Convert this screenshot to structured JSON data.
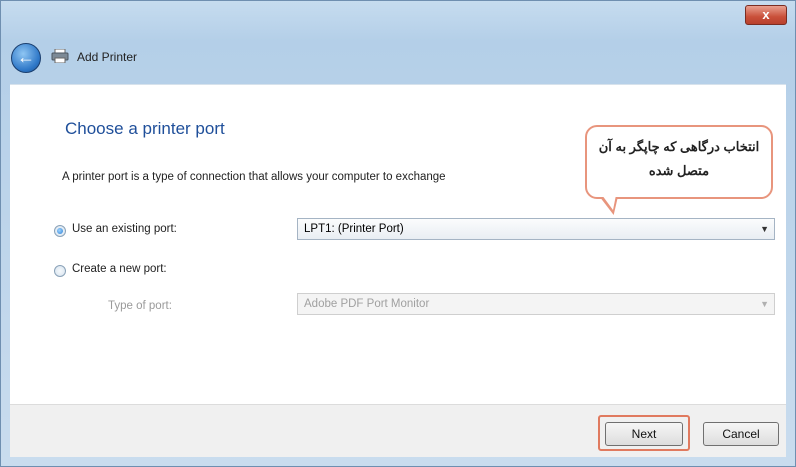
{
  "window": {
    "title": "Add Printer",
    "close_label": "x"
  },
  "icons": {
    "back": "back-arrow-icon",
    "printer": "printer-icon"
  },
  "main": {
    "heading": "Choose a printer port",
    "description": "A printer port is a type of connection that allows your computer to exchange",
    "existing_port": {
      "label": "Use an existing port:",
      "selected": true,
      "value": "LPT1: (Printer Port)"
    },
    "new_port": {
      "label": "Create a new port:",
      "selected": false,
      "type_label": "Type of port:",
      "type_value": "Adobe PDF Port Monitor"
    }
  },
  "callout": {
    "text": "انتخاب درگاهی که چاپگر به آن متصل شده"
  },
  "footer": {
    "next_label": "Next",
    "cancel_label": "Cancel"
  },
  "colors": {
    "heading": "#1f4f9a",
    "highlight": "#e8957d"
  }
}
